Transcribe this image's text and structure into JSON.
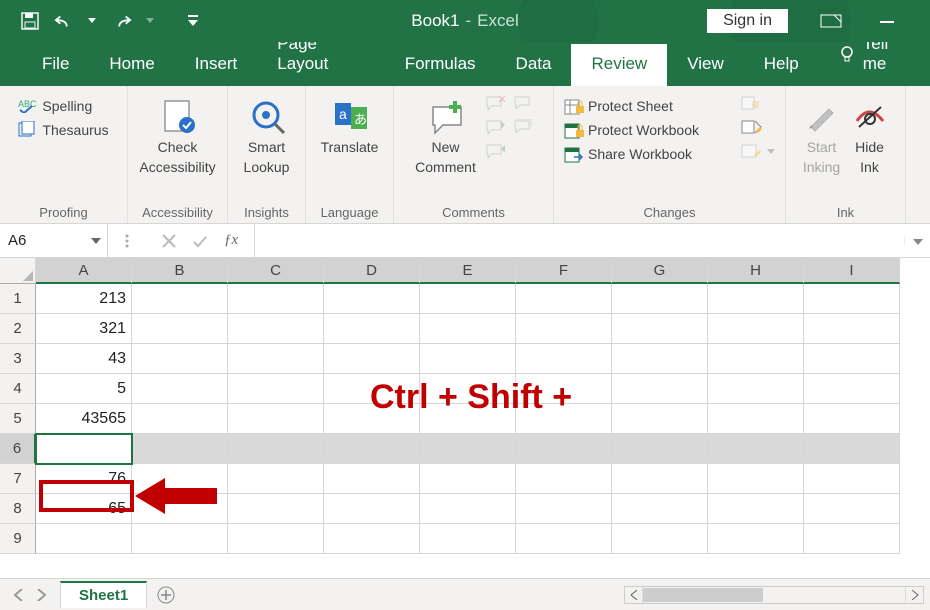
{
  "titlebar": {
    "doc": "Book1",
    "app": "Excel",
    "signin": "Sign in"
  },
  "tabs": [
    "File",
    "Home",
    "Insert",
    "Page Layout",
    "Formulas",
    "Data",
    "Review",
    "View",
    "Help"
  ],
  "active_tab": "Review",
  "tellme": "Tell me",
  "ribbon": {
    "proofing": {
      "label": "Proofing",
      "spelling": "Spelling",
      "thesaurus": "Thesaurus"
    },
    "accessibility": {
      "label": "Accessibility",
      "check": "Check",
      "check2": "Accessibility"
    },
    "insights": {
      "label": "Insights",
      "smart": "Smart",
      "smart2": "Lookup"
    },
    "language": {
      "label": "Language",
      "translate": "Translate"
    },
    "comments": {
      "label": "Comments",
      "new": "New",
      "new2": "Comment"
    },
    "changes": {
      "label": "Changes",
      "protect_sheet": "Protect Sheet",
      "protect_workbook": "Protect Workbook",
      "share_workbook": "Share Workbook"
    },
    "ink": {
      "label": "Ink",
      "start": "Start",
      "start2": "Inking",
      "hide": "Hide",
      "hide2": "Ink"
    }
  },
  "namebox": "A6",
  "formula": "",
  "columns": [
    "A",
    "B",
    "C",
    "D",
    "E",
    "F",
    "G",
    "H",
    "I"
  ],
  "rows": [
    {
      "n": "1",
      "cells": [
        "213",
        "",
        "",
        "",
        "",
        "",
        "",
        "",
        ""
      ]
    },
    {
      "n": "2",
      "cells": [
        "321",
        "",
        "",
        "",
        "",
        "",
        "",
        "",
        ""
      ]
    },
    {
      "n": "3",
      "cells": [
        "43",
        "",
        "",
        "",
        "",
        "",
        "",
        "",
        ""
      ]
    },
    {
      "n": "4",
      "cells": [
        "5",
        "",
        "",
        "",
        "",
        "",
        "",
        "",
        ""
      ]
    },
    {
      "n": "5",
      "cells": [
        "43565",
        "",
        "",
        "",
        "",
        "",
        "",
        "",
        ""
      ]
    },
    {
      "n": "6",
      "cells": [
        "",
        "",
        "",
        "",
        "",
        "",
        "",
        "",
        ""
      ]
    },
    {
      "n": "7",
      "cells": [
        "76",
        "",
        "",
        "",
        "",
        "",
        "",
        "",
        ""
      ]
    },
    {
      "n": "8",
      "cells": [
        "65",
        "",
        "",
        "",
        "",
        "",
        "",
        "",
        ""
      ]
    },
    {
      "n": "9",
      "cells": [
        "",
        "",
        "",
        "",
        "",
        "",
        "",
        "",
        ""
      ]
    }
  ],
  "selected_row_index": 5,
  "sheet": "Sheet1",
  "annotation": "Ctrl + Shift +"
}
